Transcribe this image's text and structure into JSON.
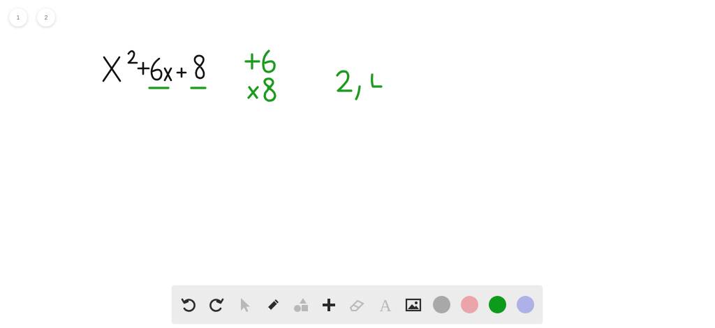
{
  "pages": [
    {
      "label": "1"
    },
    {
      "label": "2"
    }
  ],
  "toolbar": {
    "tools": [
      {
        "name": "undo-icon"
      },
      {
        "name": "redo-icon"
      },
      {
        "name": "pointer-icon"
      },
      {
        "name": "pencil-icon"
      },
      {
        "name": "shapes-icon"
      },
      {
        "name": "plus-icon"
      },
      {
        "name": "eraser-icon"
      },
      {
        "name": "text-icon",
        "glyph": "A"
      },
      {
        "name": "image-icon"
      }
    ],
    "colors": [
      "#a8a8a8",
      "#eba5aa",
      "#0e9a1a",
      "#aeb0e8"
    ]
  }
}
